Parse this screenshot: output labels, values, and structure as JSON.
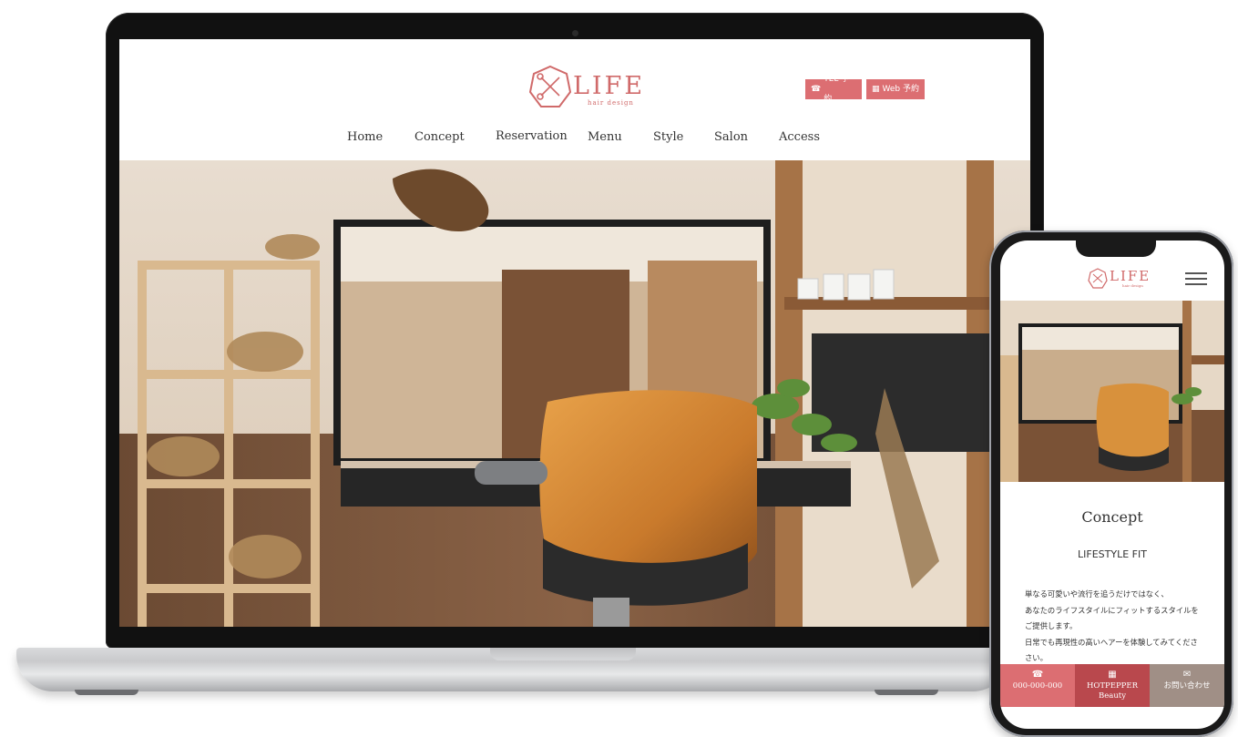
{
  "desktop": {
    "logo": {
      "text": "LIFE",
      "sub": "hair design"
    },
    "buttons": {
      "tel": "TEL 予約",
      "web": "Web 予約"
    },
    "nav": [
      "Home",
      "Concept",
      "Reservation",
      "Menu",
      "Style",
      "Salon",
      "Access"
    ]
  },
  "mobile": {
    "logo": {
      "text": "LIFE",
      "sub": "hair design"
    },
    "concept_title": "Concept",
    "concept_subtitle": "LIFESTYLE FIT",
    "concept_text": [
      "単なる可愛いや流行を追うだけではなく、",
      "あなたのライフスタイルにフィットするスタイルを",
      "ご提供します。",
      "日常でも再現性の高いヘアーを体験してみてくださ",
      "さい。"
    ],
    "footer": {
      "tel": "000-000-000",
      "hotpepper_line1": "HOTPEPPER",
      "hotpepper_line2": "Beauty",
      "contact": "お問い合わせ"
    }
  },
  "colors": {
    "accent": "#dc6e72",
    "accent_dark": "#b9484d",
    "taupe": "#a08f86"
  }
}
